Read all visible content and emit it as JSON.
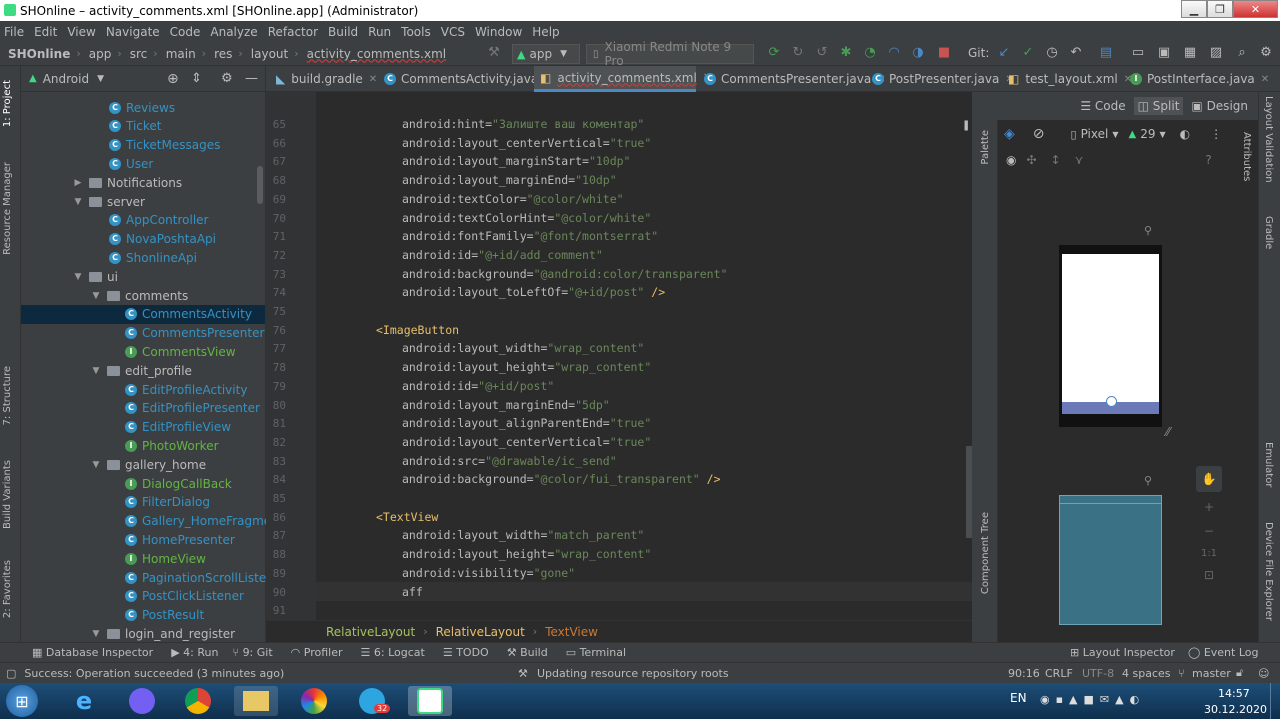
{
  "window": {
    "title": "SHOnline – activity_comments.xml [SHOnline.app] (Administrator)"
  },
  "menu": [
    "File",
    "Edit",
    "View",
    "Navigate",
    "Code",
    "Analyze",
    "Refactor",
    "Build",
    "Run",
    "Tools",
    "VCS",
    "Window",
    "Help"
  ],
  "breadcrumbs": [
    "SHOnline",
    "app",
    "src",
    "main",
    "res",
    "layout",
    "activity_comments.xml"
  ],
  "run_config": "app",
  "device": "Xiaomi Redmi Note 9 Pro",
  "git_label": "Git:",
  "project": {
    "view": "Android",
    "rows": [
      {
        "label": "Reviews",
        "kind": "class",
        "indent": 88
      },
      {
        "label": "Ticket",
        "kind": "class",
        "indent": 88
      },
      {
        "label": "TicketMessages",
        "kind": "class",
        "indent": 88
      },
      {
        "label": "User",
        "kind": "class",
        "indent": 88
      },
      {
        "label": "Notifications",
        "kind": "folder",
        "indent": 52,
        "arrow": "▶"
      },
      {
        "label": "server",
        "kind": "folder",
        "indent": 52,
        "arrow": "▼"
      },
      {
        "label": "AppController",
        "kind": "class",
        "indent": 88
      },
      {
        "label": "NovaPoshtaApi",
        "kind": "class",
        "indent": 88
      },
      {
        "label": "ShonlineApi",
        "kind": "class",
        "indent": 88
      },
      {
        "label": "ui",
        "kind": "folder",
        "indent": 52,
        "arrow": "▼"
      },
      {
        "label": "comments",
        "kind": "folder",
        "indent": 70,
        "arrow": "▼"
      },
      {
        "label": "CommentsActivity",
        "kind": "class",
        "indent": 104,
        "selected": true
      },
      {
        "label": "CommentsPresenter",
        "kind": "class",
        "indent": 104
      },
      {
        "label": "CommentsView",
        "kind": "interface",
        "indent": 104
      },
      {
        "label": "edit_profile",
        "kind": "folder",
        "indent": 70,
        "arrow": "▼"
      },
      {
        "label": "EditProfileActivity",
        "kind": "class",
        "indent": 104
      },
      {
        "label": "EditProfilePresenter",
        "kind": "class",
        "indent": 104
      },
      {
        "label": "EditProfileView",
        "kind": "class",
        "indent": 104
      },
      {
        "label": "PhotoWorker",
        "kind": "interface",
        "indent": 104
      },
      {
        "label": "gallery_home",
        "kind": "folder",
        "indent": 70,
        "arrow": "▼"
      },
      {
        "label": "DialogCallBack",
        "kind": "interface",
        "indent": 104
      },
      {
        "label": "FilterDialog",
        "kind": "class",
        "indent": 104
      },
      {
        "label": "Gallery_HomeFragment",
        "kind": "class",
        "indent": 104
      },
      {
        "label": "HomePresenter",
        "kind": "class",
        "indent": 104
      },
      {
        "label": "HomeView",
        "kind": "interface",
        "indent": 104
      },
      {
        "label": "PaginationScrollListener",
        "kind": "class",
        "indent": 104
      },
      {
        "label": "PostClickListener",
        "kind": "class",
        "indent": 104
      },
      {
        "label": "PostResult",
        "kind": "class",
        "indent": 104
      },
      {
        "label": "login_and_register",
        "kind": "folder",
        "indent": 70,
        "arrow": "▼"
      }
    ]
  },
  "tabs": [
    {
      "label": "build.gradle",
      "active": false
    },
    {
      "label": "CommentsActivity.java",
      "active": false
    },
    {
      "label": "activity_comments.xml",
      "active": true
    },
    {
      "label": "CommentsPresenter.java",
      "active": false
    },
    {
      "label": "PostPresenter.java",
      "active": false
    },
    {
      "label": "test_layout.xml",
      "active": false
    },
    {
      "label": "PostInterface.java",
      "active": false
    }
  ],
  "view_modes": [
    "Code",
    "Split",
    "Design"
  ],
  "code_lines": [
    {
      "n": "65",
      "indent": 1,
      "a": "android:hint=",
      "v": "\"Залиште ваш коментар\""
    },
    {
      "n": "66",
      "indent": 1,
      "a": "android:layout_centerVertical=",
      "v": "\"true\""
    },
    {
      "n": "67",
      "indent": 1,
      "a": "android:layout_marginStart=",
      "v": "\"10dp\""
    },
    {
      "n": "68",
      "indent": 1,
      "a": "android:layout_marginEnd=",
      "v": "\"10dp\""
    },
    {
      "n": "69",
      "indent": 1,
      "a": "android:textColor=",
      "v": "\"@color/white\""
    },
    {
      "n": "70",
      "indent": 1,
      "a": "android:textColorHint=",
      "v": "\"@color/white\""
    },
    {
      "n": "71",
      "indent": 1,
      "a": "android:fontFamily=",
      "v": "\"@font/montserrat\""
    },
    {
      "n": "72",
      "indent": 1,
      "a": "android:id=",
      "v": "\"@+id/add_comment\""
    },
    {
      "n": "73",
      "indent": 1,
      "a": "android:background=",
      "v": "\"@android:color/transparent\""
    },
    {
      "n": "74",
      "indent": 1,
      "a": "android:layout_toLeftOf=",
      "v": "\"@+id/post\"",
      "end": " />"
    },
    {
      "n": "75",
      "indent": 0,
      "a": "",
      "v": ""
    },
    {
      "n": "76",
      "indent": 0,
      "tag": "<ImageButton"
    },
    {
      "n": "77",
      "indent": 1,
      "a": "android:layout_width=",
      "v": "\"wrap_content\""
    },
    {
      "n": "78",
      "indent": 1,
      "a": "android:layout_height=",
      "v": "\"wrap_content\""
    },
    {
      "n": "79",
      "indent": 1,
      "a": "android:id=",
      "v": "\"@+id/post\""
    },
    {
      "n": "80",
      "indent": 1,
      "a": "android:layout_marginEnd=",
      "v": "\"5dp\""
    },
    {
      "n": "81",
      "indent": 1,
      "a": "android:layout_alignParentEnd=",
      "v": "\"true\""
    },
    {
      "n": "82",
      "indent": 1,
      "a": "android:layout_centerVertical=",
      "v": "\"true\""
    },
    {
      "n": "83",
      "indent": 1,
      "a": "android:src=",
      "v": "\"@drawable/ic_send\""
    },
    {
      "n": "84",
      "indent": 1,
      "a": "android:background=",
      "v": "\"@color/fui_transparent\"",
      "end": " />"
    },
    {
      "n": "85",
      "indent": 0,
      "a": "",
      "v": ""
    },
    {
      "n": "86",
      "indent": 0,
      "tag": "<TextView"
    },
    {
      "n": "87",
      "indent": 1,
      "a": "android:layout_width=",
      "v": "\"match_parent\""
    },
    {
      "n": "88",
      "indent": 1,
      "a": "android:layout_height=",
      "v": "\"wrap_content\""
    },
    {
      "n": "89",
      "indent": 1,
      "a": "android:visibility=",
      "v": "\"gone\""
    },
    {
      "n": "90",
      "indent": 1,
      "a": "aff",
      "v": ""
    },
    {
      "n": "91",
      "indent": 0,
      "a": "",
      "v": ""
    }
  ],
  "editor_breadcrumb": [
    "RelativeLayout",
    "RelativeLayout",
    "TextView"
  ],
  "design_toolbar": {
    "pixel": "Pixel",
    "api": "29"
  },
  "side_labels": {
    "left": [
      "1: Project",
      "Resource Manager",
      "7: Structure",
      "Build Variants",
      "2: Favorites"
    ],
    "right": [
      "Layout Validation",
      "Attributes",
      "Gradle",
      "Emulator",
      "Device File Explorer"
    ],
    "palette": "Palette",
    "component_tree": "Component Tree"
  },
  "preview_zoom": "1:1",
  "tool_windows": [
    "Database Inspector",
    "4: Run",
    "9: Git",
    "Profiler",
    "6: Logcat",
    "TODO",
    "Build",
    "Terminal",
    "Layout Inspector",
    "Event Log"
  ],
  "status": {
    "message": "Success: Operation succeeded (3 minutes ago)",
    "progress": "Updating resource repository roots",
    "position": "90:16",
    "line_sep": "CRLF",
    "encoding": "UTF-8",
    "indent": "4 spaces",
    "branch": "master"
  },
  "taskbar": {
    "lang": "EN",
    "time": "14:57",
    "date": "30.12.2020",
    "telegram_badge": "32"
  }
}
